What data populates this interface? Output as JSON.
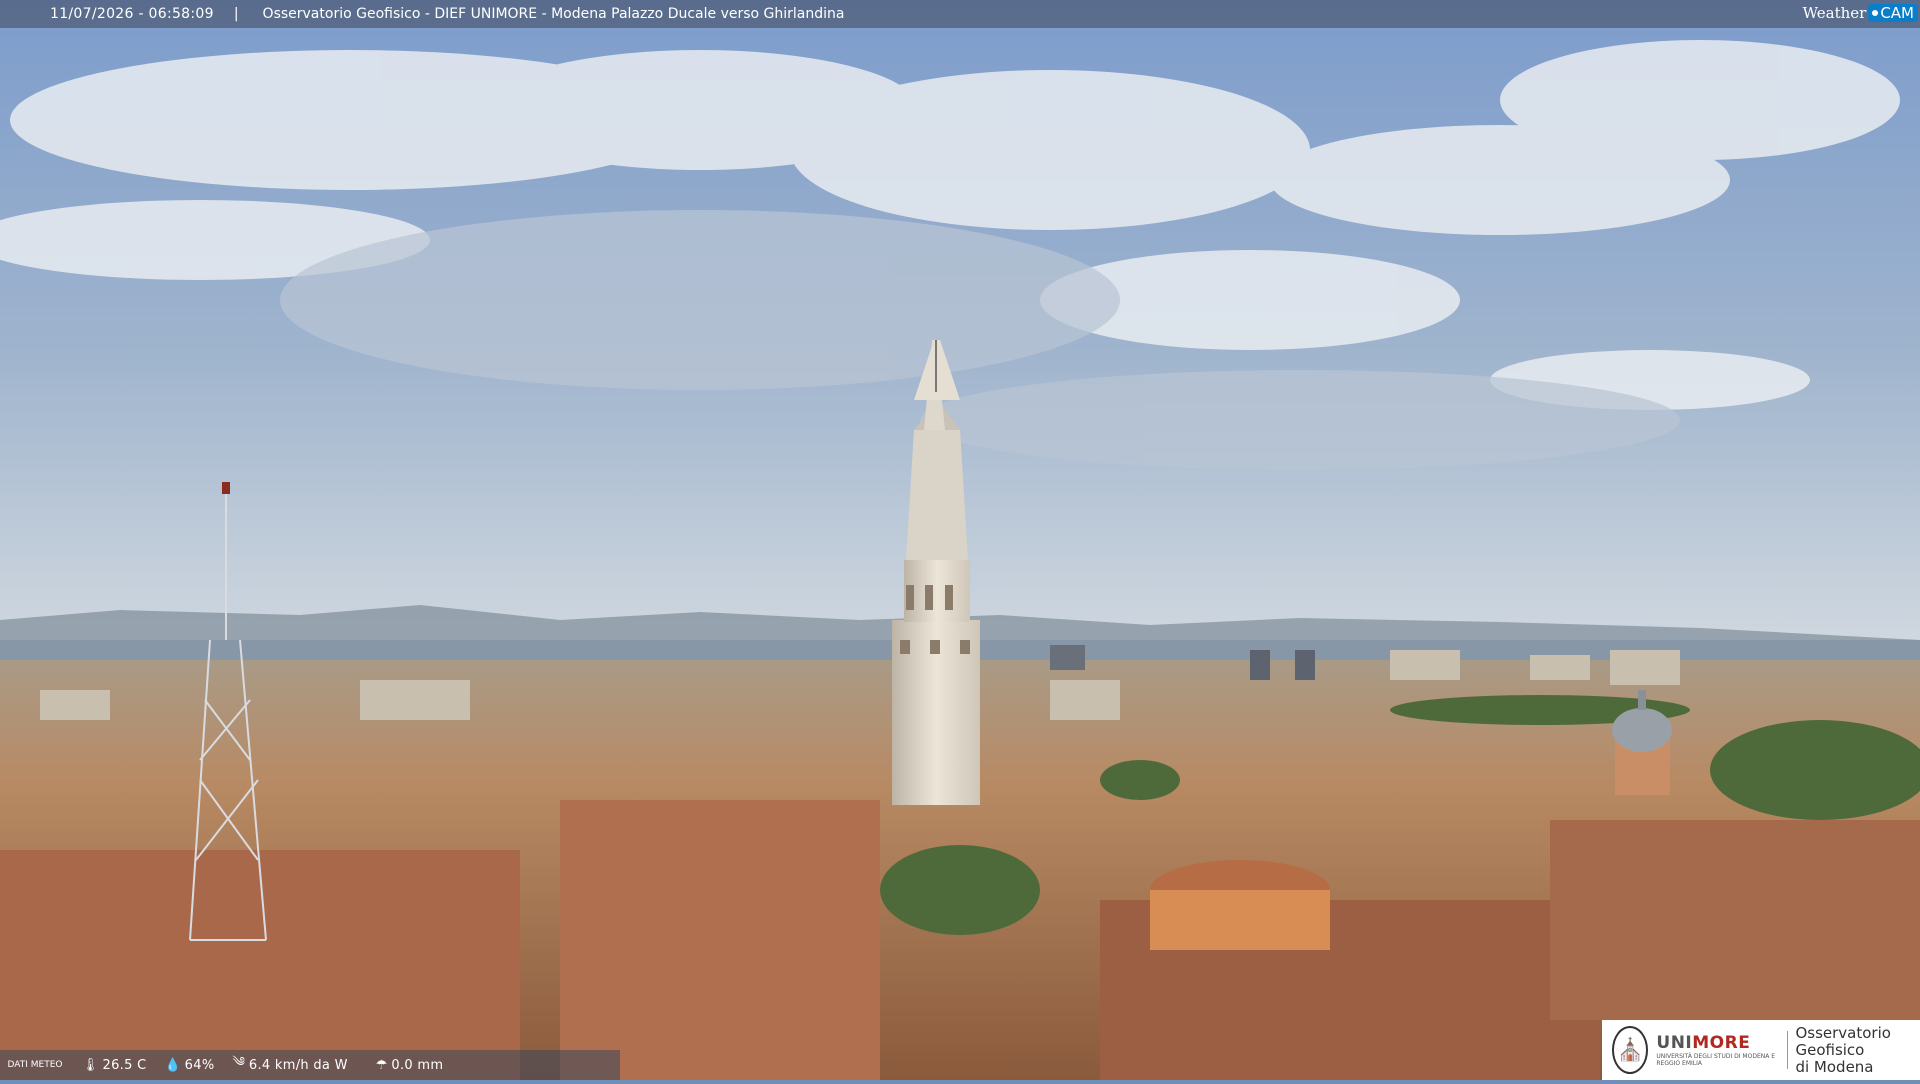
{
  "camera": {
    "timestamp": "11/07/2026 - 06:58:09",
    "separator": "|",
    "location_title": "Osservatorio Geofisico - DIEF UNIMORE - Modena Palazzo Ducale verso Ghirlandina"
  },
  "brand": {
    "weather_text": "Weather",
    "cam_text": "CAM"
  },
  "weather_data": {
    "label": "DATI METEO",
    "temperature": "26.5 C",
    "humidity": "64%",
    "wind": "6.4 km/h da W",
    "rain": "0.0 mm",
    "icons": [
      "thermometer-icon",
      "humidity-drop-icon",
      "wind-icon",
      "rain-icon"
    ]
  },
  "institution": {
    "name_uni": "UNI",
    "name_more": "MORE",
    "subtitle": "UNIVERSITÀ DEGLI STUDI DI MODENA E REGGIO EMILIA",
    "observatory_line1": "Osservatorio Geofisico",
    "observatory_line2": "di Modena"
  },
  "colors": {
    "sky_top": "#7d9ccc",
    "sky_horizon": "#cfd7df",
    "roof": "#b8764f",
    "tower": "#e6dfd3",
    "accent_red": "#b0281f"
  }
}
